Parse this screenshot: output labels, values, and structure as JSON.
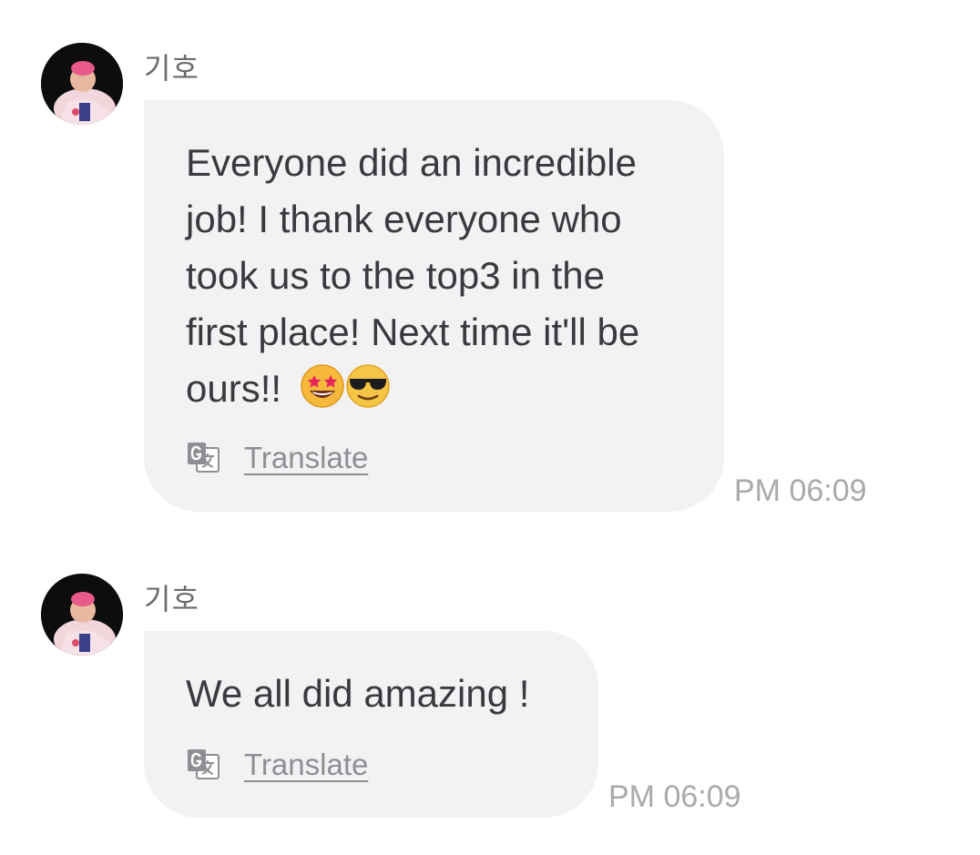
{
  "chat": {
    "messages": [
      {
        "sender": "기호",
        "text": "Everyone did an incredible\njob! I thank everyone who\ntook us to the top3 in the\nfirst place! Next time it'll be\nours!!",
        "emojis": [
          "star-struck-emoji",
          "sunglasses-emoji"
        ],
        "translate_label": "Translate",
        "time": "PM 06:09"
      },
      {
        "sender": "기호",
        "text": "We all did amazing !",
        "translate_label": "Translate",
        "time": "PM 06:09"
      }
    ]
  },
  "colors": {
    "bubble_bg": "#f2f2f4",
    "text": "#3a3a3e",
    "muted": "#8e8e93",
    "timestamp": "#a9a9ae"
  },
  "icons": {
    "translate": "translate-icon",
    "avatar": "avatar"
  }
}
